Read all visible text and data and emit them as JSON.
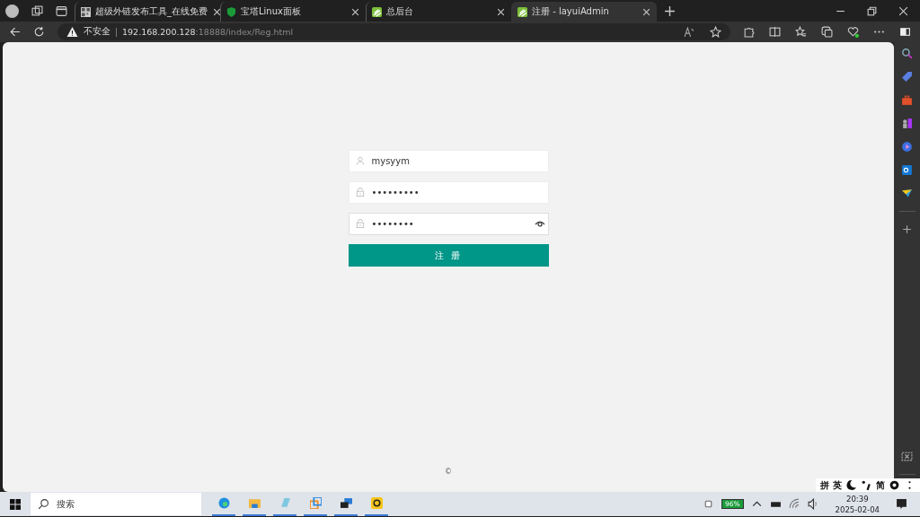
{
  "browser": {
    "tabs": [
      {
        "title": "超级外链发布工具_在线免费",
        "selected": false
      },
      {
        "title": "宝塔Linux面板",
        "selected": false
      },
      {
        "title": "总后台",
        "selected": false
      },
      {
        "title": "注册 - layuiAdmin",
        "selected": true
      }
    ],
    "security": "不安全",
    "url_host": "192.168.200.128",
    "url_rest": ":18888/index/Reg.html"
  },
  "form": {
    "fields": [
      {
        "kind": "user",
        "value": "mysyym",
        "eye": false
      },
      {
        "kind": "lock",
        "value": "•••••••••",
        "eye": false
      },
      {
        "kind": "lock",
        "value": "••••••••",
        "eye": true
      }
    ],
    "submit": "注 册",
    "footer": "©"
  },
  "taskbar": {
    "search_placeholder": "搜索",
    "battery": "96%",
    "time": "20:39",
    "date": "2025-02-04",
    "ime": [
      "拼",
      "英",
      "简"
    ]
  }
}
